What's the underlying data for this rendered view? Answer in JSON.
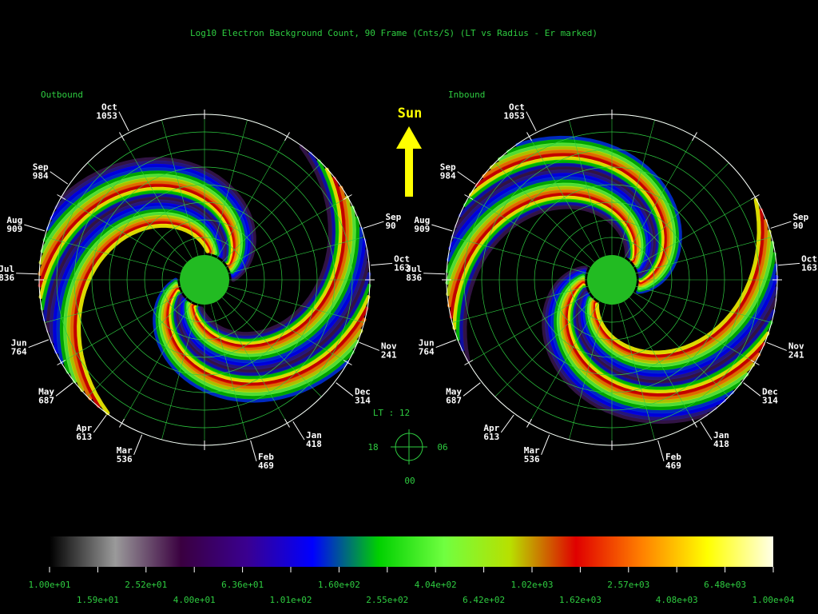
{
  "title": "Log10 Electron Background Count, 90 Frame (Cnts/S)  (LT vs Radius - Er marked)",
  "sun_label": "Sun",
  "lt_key": {
    "label": "LT : 12",
    "left": "18",
    "right": "06",
    "bottom": "00"
  },
  "panels": [
    {
      "name": "Outbound",
      "months": [
        {
          "month": "Oct",
          "day": "1053"
        },
        {
          "month": "Sep",
          "day": "984"
        },
        {
          "month": "Aug",
          "day": "909"
        },
        {
          "month": "Jul",
          "day": "836"
        },
        {
          "month": "Jun",
          "day": "764"
        },
        {
          "month": "May",
          "day": "687"
        },
        {
          "month": "Apr",
          "day": "613"
        },
        {
          "month": "Mar",
          "day": "536"
        },
        {
          "month": "Feb",
          "day": "469"
        },
        {
          "month": "Jan",
          "day": "418"
        },
        {
          "month": "Dec",
          "day": "314"
        },
        {
          "month": "Nov",
          "day": "241"
        },
        {
          "month": "Oct",
          "day": "163"
        },
        {
          "month": "Sep",
          "day": "90"
        }
      ]
    },
    {
      "name": "Inbound",
      "months": [
        {
          "month": "Oct",
          "day": "1053"
        },
        {
          "month": "Sep",
          "day": "984"
        },
        {
          "month": "Aug",
          "day": "909"
        },
        {
          "month": "Jul",
          "day": "836"
        },
        {
          "month": "Jun",
          "day": "764"
        },
        {
          "month": "May",
          "day": "687"
        },
        {
          "month": "Apr",
          "day": "613"
        },
        {
          "month": "Mar",
          "day": "536"
        },
        {
          "month": "Feb",
          "day": "469"
        },
        {
          "month": "Jan",
          "day": "418"
        },
        {
          "month": "Dec",
          "day": "314"
        },
        {
          "month": "Nov",
          "day": "241"
        },
        {
          "month": "Oct",
          "day": "163"
        },
        {
          "month": "Sep",
          "day": "90"
        }
      ]
    }
  ],
  "colorbar": {
    "stops": [
      "#000000",
      "#9a9a9a",
      "#3a0040",
      "#3a0090",
      "#0000ff",
      "#00d000",
      "#70ff40",
      "#b8e000",
      "#e00000",
      "#ff8000",
      "#ffff00",
      "#ffffe8"
    ],
    "ticks_top": [
      "1.00e+01",
      "2.52e+01",
      "6.36e+01",
      "1.60e+02",
      "4.04e+02",
      "1.02e+03",
      "2.57e+03",
      "6.48e+03"
    ],
    "ticks_bottom": [
      "1.59e+01",
      "4.00e+01",
      "1.01e+02",
      "2.55e+02",
      "6.42e+02",
      "1.62e+03",
      "4.08e+03",
      "1.00e+04"
    ]
  },
  "chart_data": {
    "type": "heatmap",
    "title": "Log10 Electron Background Count, 90 Frame (Cnts/S)  (LT vs Radius - Er marked)",
    "coordinates": "polar (LT vs Radius)",
    "value_range": [
      10,
      10000
    ],
    "scale": "log10",
    "panels": [
      "Outbound",
      "Inbound"
    ],
    "orbit_labels": [
      "Oct 1053",
      "Sep 984",
      "Aug 909",
      "Jul 836",
      "Jun 764",
      "May 687",
      "Apr 613",
      "Mar 536",
      "Feb 469",
      "Jan 418",
      "Dec 314",
      "Nov 241",
      "Oct 163",
      "Sep 90"
    ],
    "colors": {
      "grid": "#2ecc40",
      "planet": "#22bb22",
      "sun_arrow": "#ffff00",
      "labels": "#ffffff"
    }
  }
}
